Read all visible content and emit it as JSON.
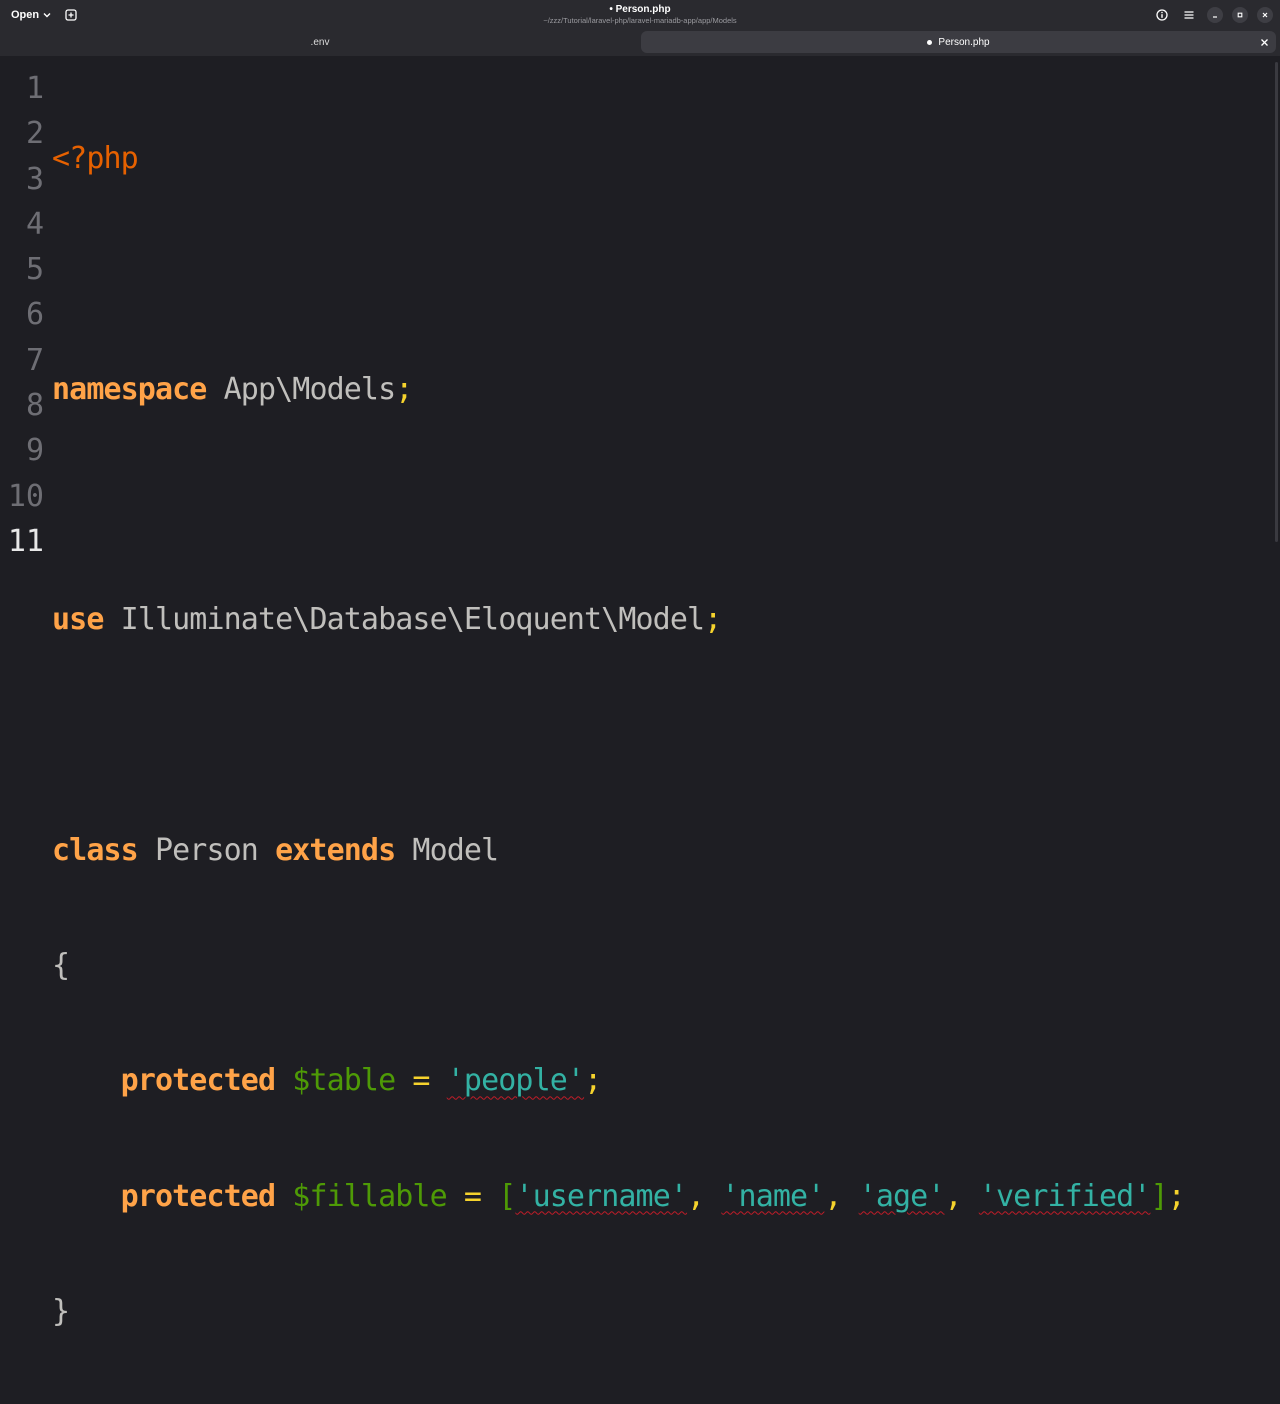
{
  "header": {
    "open_label": "Open",
    "title": "• Person.php",
    "subtitle": "~/zzz/Tutorial/laravel-php/laravel-mariadb-app/app/Models",
    "icons": [
      "chevron-down-icon",
      "new-tab-icon",
      "info-icon",
      "menu-icon",
      "minimize-icon",
      "maximize-icon",
      "close-icon"
    ]
  },
  "tabs": [
    {
      "label": ".env",
      "active": false
    },
    {
      "label": "Person.php",
      "active": true,
      "modified": true
    }
  ],
  "editor": {
    "line_numbers": [
      "1",
      "2",
      "3",
      "4",
      "5",
      "6",
      "7",
      "8",
      "9",
      "10",
      "11"
    ],
    "current_line": "11",
    "tokens": {
      "l1_open": "<?php",
      "l3_kw": "namespace",
      "l3_name": " App\\Models",
      "l3_semi": ";",
      "l5_kw": "use",
      "l5_name": " Illuminate\\Database\\Eloquent\\Model",
      "l5_semi": ";",
      "l7_kw1": "class",
      "l7_name1": " Person ",
      "l7_kw2": "extends",
      "l7_name2": " Model",
      "l8_brace": "{",
      "indent": "    ",
      "l9_kw": "protected",
      "l9_var": " $table",
      "l9_eq": " = ",
      "l9_str": "'people'",
      "l9_semi": ";",
      "l10_kw": "protected",
      "l10_var": " $fillable",
      "l10_eq": " = ",
      "l10_open": "[",
      "l10_s1": "'username'",
      "comma": ", ",
      "l10_s2": "'name'",
      "l10_s3": "'age'",
      "l10_s4": "'verified'",
      "l10_close": "]",
      "l10_semi": ";",
      "l11_brace": "}"
    }
  },
  "colors": {
    "background": "#1e1e23",
    "keyword": "#ffa348",
    "php_tag": "#e66100",
    "string": "#33b2a4",
    "variable": "#4e9a06",
    "spell_underline": "#c01c28"
  }
}
